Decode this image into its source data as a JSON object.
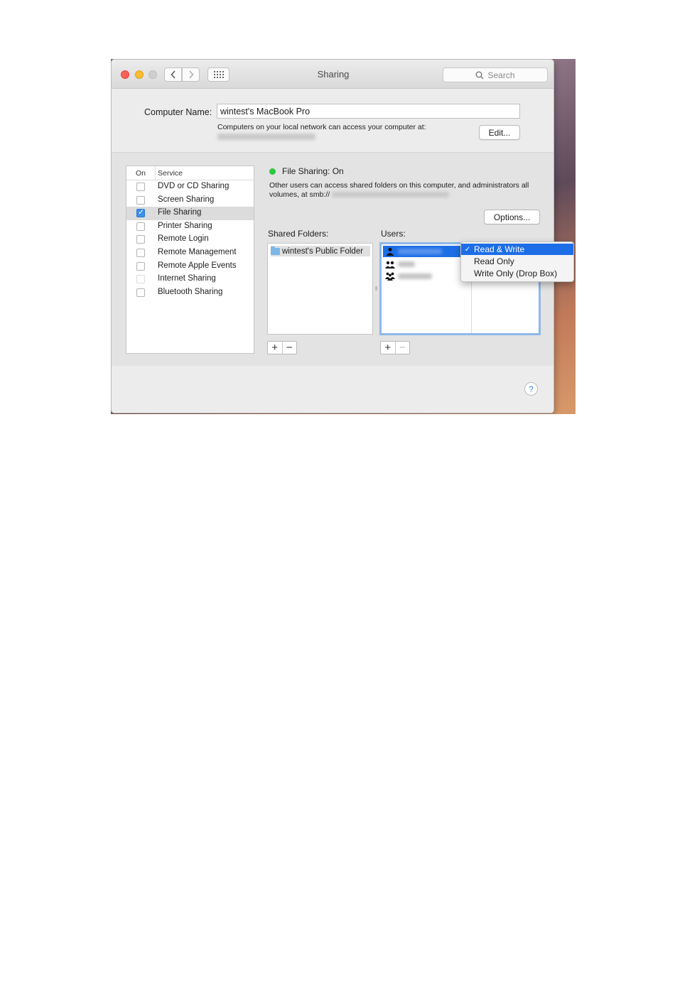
{
  "window": {
    "title": "Sharing",
    "search_placeholder": "Search"
  },
  "computer_name": {
    "label": "Computer Name:",
    "value": "wintest's MacBook Pro",
    "note": "Computers on your local network can access your computer at:",
    "edit_button": "Edit..."
  },
  "services": {
    "header_on": "On",
    "header_service": "Service",
    "items": [
      {
        "label": "DVD or CD Sharing",
        "checked": false
      },
      {
        "label": "Screen Sharing",
        "checked": false
      },
      {
        "label": "File Sharing",
        "checked": true
      },
      {
        "label": "Printer Sharing",
        "checked": false
      },
      {
        "label": "Remote Login",
        "checked": false
      },
      {
        "label": "Remote Management",
        "checked": false
      },
      {
        "label": "Remote Apple Events",
        "checked": false
      },
      {
        "label": "Internet Sharing",
        "checked": false
      },
      {
        "label": "Bluetooth Sharing",
        "checked": false
      }
    ]
  },
  "file_sharing": {
    "status": "File Sharing: On",
    "description": "Other users can access shared folders on this computer, and administrators all volumes, at smb://",
    "options_button": "Options...",
    "shared_folders_label": "Shared Folders:",
    "users_label": "Users:",
    "shared_folders": [
      "wintest's Public Folder"
    ],
    "add_symbol": "+",
    "remove_symbol": "−"
  },
  "permission_menu": {
    "items": [
      "Read & Write",
      "Read Only",
      "Write Only (Drop Box)"
    ],
    "selected_index": 0
  },
  "help_symbol": "?",
  "colors": {
    "status_on": "#2bc940",
    "accent": "#1d6ee6"
  }
}
